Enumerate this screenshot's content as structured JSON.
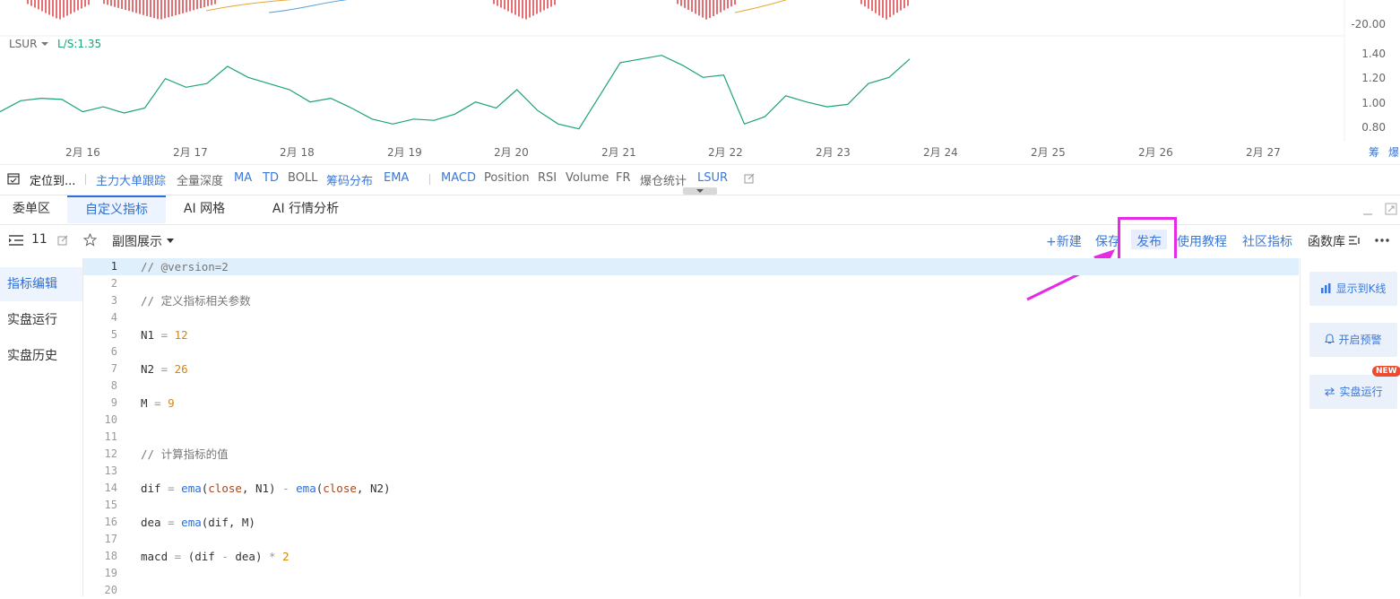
{
  "chart": {
    "top_y_label": "-20.00",
    "indicator_name": "LSUR",
    "indicator_value": "L/S:1.35",
    "y_ticks": [
      "1.40",
      "1.20",
      "1.00",
      "0.80"
    ],
    "x_ticks": [
      "2月 16",
      "2月 17",
      "2月 18",
      "2月 19",
      "2月 20",
      "2月 21",
      "2月 22",
      "2月 23",
      "2月 24",
      "2月 25",
      "2月 26",
      "2月 27"
    ],
    "corner_labels": [
      "筹",
      "爆"
    ],
    "line_color": "#1aa37a",
    "bar_color": "#e0555a"
  },
  "chart_data": {
    "type": "line",
    "ylabel": "",
    "ylim": [
      0.75,
      1.45
    ],
    "x": [
      "2月 16",
      "2月 17",
      "2月 18",
      "2月 19",
      "2月 20",
      "2月 21",
      "2月 22",
      "2月 23",
      "2月 24"
    ],
    "series": [
      {
        "name": "L/S",
        "values": [
          0.92,
          1.01,
          1.03,
          1.02,
          0.92,
          0.96,
          0.91,
          0.95,
          1.19,
          1.12,
          1.15,
          1.29,
          1.2,
          1.15,
          1.1,
          1.0,
          1.03,
          0.95,
          0.86,
          0.82,
          0.86,
          0.85,
          0.9,
          1.0,
          0.95,
          1.1,
          0.93,
          0.82,
          0.78,
          1.05,
          1.32,
          1.35,
          1.38,
          1.3,
          1.2,
          1.22,
          0.82,
          0.88,
          1.05,
          1.0,
          0.96,
          0.98,
          1.15,
          1.2,
          1.35
        ]
      }
    ]
  },
  "indicator_bar": {
    "locate_label": "定位到...",
    "items_a": [
      {
        "label": "主力大单跟踪",
        "on": true
      },
      {
        "label": "全量深度",
        "on": false
      },
      {
        "label": "MA",
        "on": true
      },
      {
        "label": "TD",
        "on": true
      },
      {
        "label": "BOLL",
        "on": false
      },
      {
        "label": "筹码分布",
        "on": true
      },
      {
        "label": "EMA",
        "on": true
      }
    ],
    "items_b": [
      {
        "label": "MACD",
        "on": true
      },
      {
        "label": "Position",
        "on": false
      },
      {
        "label": "RSI",
        "on": false
      },
      {
        "label": "Volume",
        "on": false
      },
      {
        "label": "FR",
        "on": false
      },
      {
        "label": "爆仓统计",
        "on": false
      },
      {
        "label": "LSUR",
        "on": true
      }
    ]
  },
  "tabs": [
    "委单区",
    "自定义指标",
    "AI 网格",
    "AI 行情分析"
  ],
  "active_tab": "自定义指标",
  "action_bar": {
    "count": "11",
    "view_mode": "副图展示",
    "new_label": "+新建",
    "save_label": "保存",
    "publish_label": "发布",
    "tutorial_label": "使用教程",
    "community_label": "社区指标",
    "library_label": "函数库"
  },
  "left_nav": [
    "指标编辑",
    "实盘运行",
    "实盘历史"
  ],
  "editor": {
    "lines": [
      "// @version=2",
      "",
      "// 定义指标相关参数",
      "",
      "N1 = 12",
      "",
      "N2 = 26",
      "",
      "M = 9",
      "",
      "",
      "// 计算指标的值",
      "",
      "dif = ema(close, N1) - ema(close, N2)",
      "",
      "dea = ema(dif, M)",
      "",
      "macd = (dif - dea) * 2",
      "",
      ""
    ]
  },
  "right_panel": {
    "show_kline": "显示到K线",
    "alert": "开启预警",
    "live_run": "实盘运行",
    "new_badge": "NEW"
  },
  "highlight_color": "#e52be5"
}
